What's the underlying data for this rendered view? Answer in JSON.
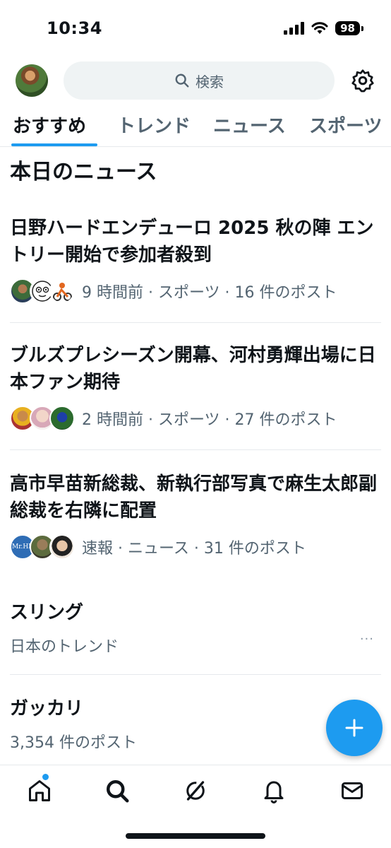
{
  "status_bar": {
    "time": "10:34",
    "battery": "98"
  },
  "header": {
    "search_placeholder": "検索"
  },
  "tabs": [
    {
      "label": "おすすめ",
      "active": true
    },
    {
      "label": "トレンド",
      "active": false
    },
    {
      "label": "ニュース",
      "active": false
    },
    {
      "label": "スポーツ",
      "active": false
    }
  ],
  "section_title": "本日のニュース",
  "news": [
    {
      "title": "日野ハードエンデューロ 2025 秋の陣 エントリー開始で参加者殺到",
      "meta": "9 時間前 · スポーツ · 16 件のポスト"
    },
    {
      "title": "ブルズプレシーズン開幕、河村勇輝出場に日本ファン期待",
      "meta": "2 時間前 · スポーツ · 27 件のポスト"
    },
    {
      "title": "高市早苗新総裁、新執行部写真で麻生太郎副総裁を右隣に配置",
      "meta": "速報 · ニュース · 31 件のポスト",
      "avatar_label": "Mr.HR"
    }
  ],
  "trends": [
    {
      "name": "スリング",
      "sub": "日本のトレンド",
      "more": "···"
    },
    {
      "name": "ガッカリ",
      "sub": "3,354 件のポスト"
    }
  ],
  "colors": {
    "accent": "#1d9bf0",
    "text": "#0f1419",
    "secondary": "#536471"
  },
  "icons": [
    "search-icon",
    "gear-icon",
    "plus-icon",
    "home-icon",
    "explore-icon",
    "grok-icon",
    "notifications-icon",
    "messages-icon"
  ]
}
